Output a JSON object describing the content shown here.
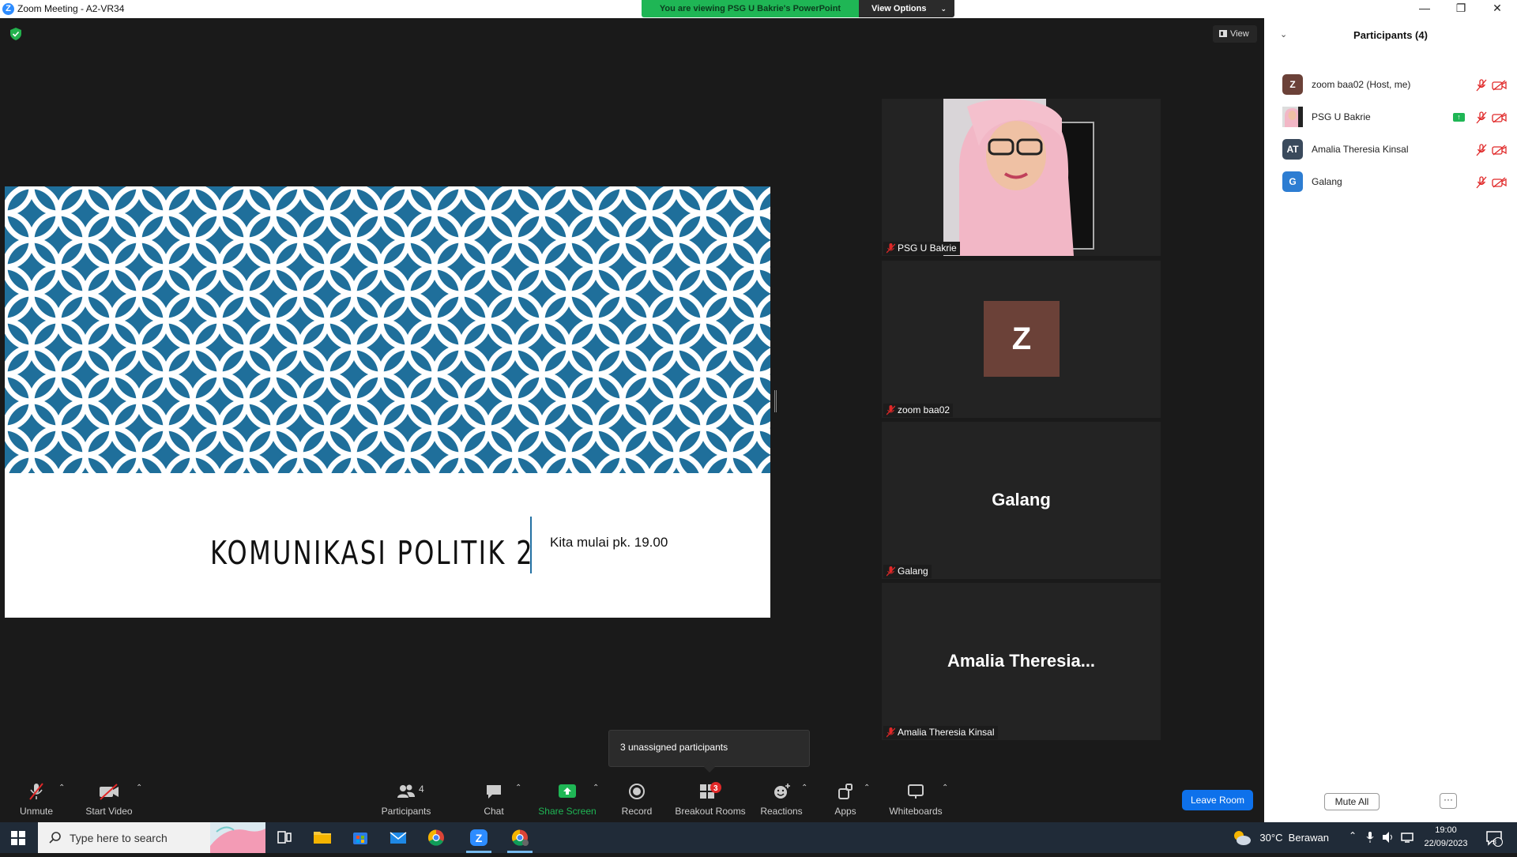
{
  "window": {
    "title": "Zoom Meeting - A2-VR34",
    "view_banner": "You are viewing PSG U Bakrie's PowerPoint",
    "view_options": "View Options",
    "view_button": "View"
  },
  "slide": {
    "title": "KOMUNIKASI POLITIK 2",
    "subtitle": "Kita mulai pk. 19.00",
    "pattern_color": "#1f6f9b"
  },
  "tiles": [
    {
      "name": "PSG U Bakrie",
      "mode": "video"
    },
    {
      "name": "zoom baa02",
      "mode": "avatar",
      "initial": "Z"
    },
    {
      "name": "Galang",
      "mode": "text",
      "display": "Galang"
    },
    {
      "name": "Amalia Theresia Kinsal",
      "mode": "text",
      "display": "Amalia  Theresia..."
    }
  ],
  "participants_panel": {
    "title": "Participants (4)",
    "items": [
      {
        "initials": "Z",
        "name": "zoom baa02 (Host, me)",
        "avatar_color": "#6b4138"
      },
      {
        "initials": "",
        "name": "PSG U Bakrie",
        "avatar_color": "#e8c4cc",
        "sharing": true
      },
      {
        "initials": "AT",
        "name": "Amalia Theresia Kinsal",
        "avatar_color": "#3a4a5c"
      },
      {
        "initials": "G",
        "name": "Galang",
        "avatar_color": "#2d7dd2"
      }
    ],
    "mute_all": "Mute All",
    "more": "···"
  },
  "tooltip": "3 unassigned participants",
  "toolbar": {
    "unmute": "Unmute",
    "start_video": "Start Video",
    "participants": "Participants",
    "participants_count": "4",
    "chat": "Chat",
    "share_screen": "Share Screen",
    "record": "Record",
    "breakout_rooms": "Breakout Rooms",
    "breakout_badge": "3",
    "reactions": "Reactions",
    "apps": "Apps",
    "whiteboards": "Whiteboards",
    "leave_room": "Leave Room"
  },
  "taskbar": {
    "search_placeholder": "Type here to search",
    "weather": "30°C  Berawan",
    "time": "19:00",
    "date": "22/09/2023",
    "notifications": "3"
  },
  "colors": {
    "accent": "#0e71eb",
    "share_green": "#1fb655",
    "muted_red": "#e02828"
  }
}
